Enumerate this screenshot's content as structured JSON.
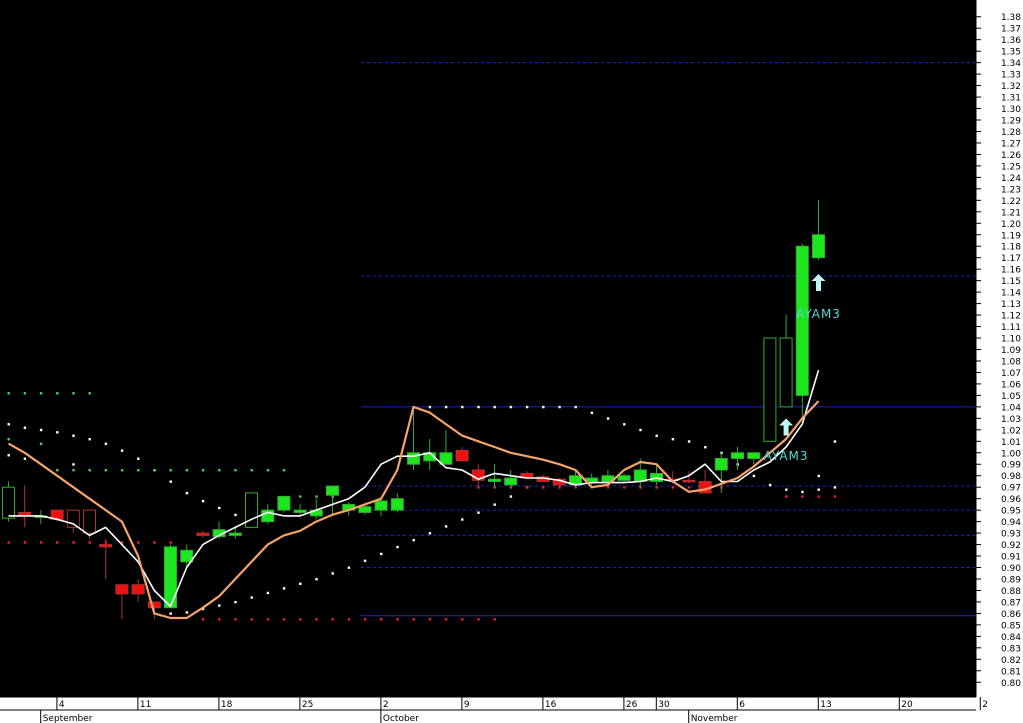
{
  "colors": {
    "background": "#000000",
    "panel": "#ffffff",
    "bull_candle": "#1ee61e",
    "bull_outline": "#33aa33",
    "bear_candle": "#ee1111",
    "bear_outline": "#aa3333",
    "fast_ma": "#ffffff",
    "slow_ma": "#f4a46a",
    "level_line": "#2222cc",
    "signal": "#55d7d7"
  },
  "chart_data": {
    "type": "candlestick",
    "title": "",
    "ylim": [
      0.795,
      1.385
    ],
    "y_ticks": [
      "1.38",
      "1.37",
      "1.36",
      "1.35",
      "1.34",
      "1.33",
      "1.32",
      "1.31",
      "1.30",
      "1.29",
      "1.28",
      "1.27",
      "1.26",
      "1.25",
      "1.24",
      "1.23",
      "1.22",
      "1.21",
      "1.20",
      "1.19",
      "1.18",
      "1.17",
      "1.16",
      "1.15",
      "1.14",
      "1.13",
      "1.12",
      "1.11",
      "1.10",
      "1.09",
      "1.08",
      "1.07",
      "1.06",
      "1.05",
      "1.04",
      "1.03",
      "1.02",
      "1.01",
      "1.00",
      "0.99",
      "0.98",
      "0.97",
      "0.96",
      "0.95",
      "0.94",
      "0.93",
      "0.92",
      "0.91",
      "0.90",
      "0.89",
      "0.88",
      "0.87",
      "0.86",
      "0.85",
      "0.84",
      "0.83",
      "0.82",
      "0.81",
      "0.80"
    ],
    "x_day_labels": [
      {
        "i": 2,
        "label": "4"
      },
      {
        "i": 7,
        "label": "11"
      },
      {
        "i": 12,
        "label": "18"
      },
      {
        "i": 17,
        "label": "25"
      },
      {
        "i": 22,
        "label": "2"
      },
      {
        "i": 27,
        "label": "9"
      },
      {
        "i": 32,
        "label": "16"
      },
      {
        "i": 37,
        "label": "26"
      },
      {
        "i": 39,
        "label": "30"
      },
      {
        "i": 44,
        "label": "6"
      },
      {
        "i": 49,
        "label": "13"
      },
      {
        "i": 54,
        "label": "20"
      },
      {
        "i": 59,
        "label": "2"
      }
    ],
    "x_month_labels": [
      {
        "i": 1,
        "label": "September"
      },
      {
        "i": 22,
        "label": "October"
      },
      {
        "i": 41,
        "label": "November"
      }
    ],
    "candles": [
      {
        "o": 0.943,
        "h": 0.975,
        "l": 0.94,
        "c": 0.97
      },
      {
        "o": 0.948,
        "h": 0.972,
        "l": 0.935,
        "c": 0.945
      },
      {
        "o": 0.945,
        "h": 0.95,
        "l": 0.938,
        "c": 0.945
      },
      {
        "o": 0.95,
        "h": 0.95,
        "l": 0.94,
        "c": 0.942
      },
      {
        "o": 0.95,
        "h": 0.95,
        "l": 0.93,
        "c": 0.935
      },
      {
        "o": 0.95,
        "h": 0.95,
        "l": 0.925,
        "c": 0.93
      },
      {
        "o": 0.92,
        "h": 0.925,
        "l": 0.89,
        "c": 0.918
      },
      {
        "o": 0.885,
        "h": 0.885,
        "l": 0.855,
        "c": 0.877
      },
      {
        "o": 0.885,
        "h": 0.89,
        "l": 0.87,
        "c": 0.877
      },
      {
        "o": 0.87,
        "h": 0.87,
        "l": 0.855,
        "c": 0.865
      },
      {
        "o": 0.865,
        "h": 0.92,
        "l": 0.865,
        "c": 0.918
      },
      {
        "o": 0.905,
        "h": 0.92,
        "l": 0.9,
        "c": 0.915
      },
      {
        "o": 0.93,
        "h": 0.932,
        "l": 0.926,
        "c": 0.928
      },
      {
        "o": 0.927,
        "h": 0.94,
        "l": 0.925,
        "c": 0.933
      },
      {
        "o": 0.928,
        "h": 0.935,
        "l": 0.925,
        "c": 0.93
      },
      {
        "o": 0.935,
        "h": 0.965,
        "l": 0.935,
        "c": 0.965
      },
      {
        "o": 0.94,
        "h": 0.955,
        "l": 0.938,
        "c": 0.95
      },
      {
        "o": 0.95,
        "h": 0.962,
        "l": 0.948,
        "c": 0.962
      },
      {
        "o": 0.948,
        "h": 0.955,
        "l": 0.945,
        "c": 0.95
      },
      {
        "o": 0.945,
        "h": 0.96,
        "l": 0.942,
        "c": 0.95
      },
      {
        "o": 0.963,
        "h": 0.965,
        "l": 0.945,
        "c": 0.971
      },
      {
        "o": 0.95,
        "h": 0.957,
        "l": 0.945,
        "c": 0.955
      },
      {
        "o": 0.948,
        "h": 0.955,
        "l": 0.946,
        "c": 0.953
      },
      {
        "o": 0.95,
        "h": 0.96,
        "l": 0.945,
        "c": 0.958
      },
      {
        "o": 0.95,
        "h": 0.965,
        "l": 0.948,
        "c": 0.96
      },
      {
        "o": 0.99,
        "h": 1.04,
        "l": 0.985,
        "c": 1.0
      },
      {
        "o": 0.993,
        "h": 1.012,
        "l": 0.985,
        "c": 1.0
      },
      {
        "o": 0.99,
        "h": 1.02,
        "l": 0.99,
        "c": 1.0
      },
      {
        "o": 1.002,
        "h": 1.005,
        "l": 0.995,
        "c": 0.993
      },
      {
        "o": 0.985,
        "h": 0.99,
        "l": 0.97,
        "c": 0.976
      },
      {
        "o": 0.975,
        "h": 0.99,
        "l": 0.97,
        "c": 0.977
      },
      {
        "o": 0.972,
        "h": 0.985,
        "l": 0.97,
        "c": 0.978
      },
      {
        "o": 0.982,
        "h": 0.984,
        "l": 0.977,
        "c": 0.978
      },
      {
        "o": 0.979,
        "h": 0.981,
        "l": 0.975,
        "c": 0.975
      },
      {
        "o": 0.977,
        "h": 0.978,
        "l": 0.97,
        "c": 0.972
      },
      {
        "o": 0.972,
        "h": 0.985,
        "l": 0.97,
        "c": 0.98
      },
      {
        "o": 0.975,
        "h": 0.982,
        "l": 0.972,
        "c": 0.978
      },
      {
        "o": 0.975,
        "h": 0.985,
        "l": 0.972,
        "c": 0.98
      },
      {
        "o": 0.976,
        "h": 0.982,
        "l": 0.974,
        "c": 0.98
      },
      {
        "o": 0.975,
        "h": 0.995,
        "l": 0.97,
        "c": 0.985
      },
      {
        "o": 0.975,
        "h": 0.99,
        "l": 0.972,
        "c": 0.982
      },
      {
        "o": 0.977,
        "h": 0.984,
        "l": 0.973,
        "c": 0.976
      },
      {
        "o": 0.976,
        "h": 0.984,
        "l": 0.973,
        "c": 0.975
      },
      {
        "o": 0.975,
        "h": 0.985,
        "l": 0.972,
        "c": 0.965
      },
      {
        "o": 0.985,
        "h": 1.0,
        "l": 0.965,
        "c": 0.995
      },
      {
        "o": 0.995,
        "h": 1.005,
        "l": 0.985,
        "c": 1.0
      },
      {
        "o": 0.995,
        "h": 1.0,
        "l": 0.99,
        "c": 1.0
      },
      {
        "o": 1.01,
        "h": 1.1,
        "l": 1.01,
        "c": 1.1
      },
      {
        "o": 1.04,
        "h": 1.12,
        "l": 1.04,
        "c": 1.1
      },
      {
        "o": 1.05,
        "h": 1.182,
        "l": 1.03,
        "c": 1.18
      },
      {
        "o": 1.17,
        "h": 1.22,
        "l": 1.168,
        "c": 1.19
      }
    ],
    "series": [
      {
        "name": "",
        "values": [
          0.945,
          0.945,
          0.945,
          0.942,
          0.938,
          0.928,
          0.935,
          0.92,
          0.905,
          0.88,
          0.866,
          0.9,
          0.92,
          0.928,
          0.935,
          0.942,
          0.948,
          0.945,
          0.945,
          0.95,
          0.955,
          0.96,
          0.97,
          0.99,
          0.997,
          0.997,
          1.0,
          0.987,
          0.985,
          0.977,
          0.982,
          0.98,
          0.978,
          0.978,
          0.976,
          0.972,
          0.974,
          0.974,
          0.974,
          0.975,
          0.978,
          0.975,
          0.98,
          0.99,
          0.975,
          0.975,
          0.985,
          0.992,
          1.005,
          1.025,
          1.072
        ]
      },
      {
        "name": "",
        "values": [
          1.008,
          1.0,
          0.99,
          0.98,
          0.97,
          0.96,
          0.95,
          0.94,
          0.91,
          0.86,
          0.856,
          0.856,
          0.865,
          0.875,
          0.89,
          0.905,
          0.92,
          0.928,
          0.932,
          0.94,
          0.946,
          0.95,
          0.955,
          0.96,
          0.985,
          1.04,
          1.035,
          1.025,
          1.015,
          1.01,
          1.005,
          1.0,
          0.997,
          0.994,
          0.99,
          0.985,
          0.97,
          0.972,
          0.985,
          0.992,
          0.99,
          0.975,
          0.966,
          0.968,
          0.973,
          0.978,
          0.988,
          1.0,
          1.012,
          1.03,
          1.045
        ]
      }
    ],
    "dots": {
      "white": [
        [
          0,
          1.025
        ],
        [
          1,
          1.022
        ],
        [
          2,
          1.02
        ],
        [
          3,
          1.018
        ],
        [
          4,
          1.015
        ],
        [
          5,
          1.012
        ],
        [
          6,
          1.008
        ],
        [
          7,
          1.002
        ],
        [
          8,
          0.995
        ],
        [
          9,
          0.985
        ],
        [
          10,
          0.975
        ],
        [
          11,
          0.965
        ],
        [
          12,
          0.958
        ],
        [
          13,
          0.952
        ],
        [
          14,
          0.946
        ],
        [
          0,
          0.998
        ],
        [
          1,
          0.995
        ],
        [
          4,
          0.99
        ],
        [
          10,
          0.86
        ],
        [
          11,
          0.861
        ],
        [
          12,
          0.864
        ],
        [
          13,
          0.867
        ],
        [
          14,
          0.87
        ],
        [
          15,
          0.874
        ],
        [
          16,
          0.878
        ],
        [
          17,
          0.882
        ],
        [
          18,
          0.886
        ],
        [
          19,
          0.89
        ],
        [
          20,
          0.895
        ],
        [
          21,
          0.9
        ],
        [
          22,
          0.906
        ],
        [
          23,
          0.912
        ],
        [
          24,
          0.918
        ],
        [
          25,
          0.924
        ],
        [
          26,
          0.93
        ],
        [
          27,
          0.936
        ],
        [
          28,
          0.942
        ],
        [
          29,
          0.948
        ],
        [
          30,
          0.955
        ],
        [
          31,
          0.962
        ],
        [
          32,
          0.97
        ],
        [
          26,
          1.04
        ],
        [
          27,
          1.04
        ],
        [
          28,
          1.04
        ],
        [
          29,
          1.04
        ],
        [
          30,
          1.04
        ],
        [
          31,
          1.04
        ],
        [
          32,
          1.04
        ],
        [
          33,
          1.04
        ],
        [
          34,
          1.04
        ],
        [
          35,
          1.04
        ],
        [
          36,
          1.035
        ],
        [
          37,
          1.03
        ],
        [
          38,
          1.025
        ],
        [
          39,
          1.02
        ],
        [
          40,
          1.015
        ],
        [
          41,
          1.012
        ],
        [
          42,
          1.01
        ],
        [
          43,
          1.005
        ],
        [
          44,
          1.0
        ],
        [
          45,
          0.99
        ],
        [
          46,
          0.98
        ],
        [
          47,
          0.972
        ],
        [
          48,
          0.968
        ],
        [
          49,
          0.966
        ],
        [
          50,
          0.968
        ],
        [
          51,
          0.97
        ],
        [
          50,
          0.98
        ],
        [
          51,
          1.01
        ]
      ],
      "green": [
        [
          0,
          1.052
        ],
        [
          1,
          1.052
        ],
        [
          2,
          1.052
        ],
        [
          3,
          1.052
        ],
        [
          4,
          1.052
        ],
        [
          5,
          1.052
        ],
        [
          3,
          0.985
        ],
        [
          4,
          0.985
        ],
        [
          5,
          0.985
        ],
        [
          6,
          0.985
        ],
        [
          7,
          0.985
        ],
        [
          8,
          0.985
        ],
        [
          9,
          0.985
        ],
        [
          10,
          0.985
        ],
        [
          11,
          0.985
        ],
        [
          12,
          0.985
        ],
        [
          13,
          0.985
        ],
        [
          14,
          0.985
        ],
        [
          15,
          0.985
        ],
        [
          16,
          0.985
        ],
        [
          17,
          0.985
        ],
        [
          18,
          0.962
        ],
        [
          19,
          0.962
        ],
        [
          20,
          0.962
        ],
        [
          0,
          1.012
        ],
        [
          2,
          1.008
        ]
      ],
      "red": [
        [
          0,
          0.922
        ],
        [
          1,
          0.922
        ],
        [
          2,
          0.922
        ],
        [
          3,
          0.922
        ],
        [
          4,
          0.922
        ],
        [
          5,
          0.922
        ],
        [
          6,
          0.922
        ],
        [
          7,
          0.922
        ],
        [
          8,
          0.922
        ],
        [
          9,
          0.922
        ],
        [
          10,
          0.922
        ],
        [
          12,
          0.855
        ],
        [
          13,
          0.855
        ],
        [
          14,
          0.855
        ],
        [
          15,
          0.855
        ],
        [
          16,
          0.855
        ],
        [
          17,
          0.855
        ],
        [
          18,
          0.855
        ],
        [
          19,
          0.855
        ],
        [
          20,
          0.855
        ],
        [
          21,
          0.855
        ],
        [
          22,
          0.855
        ],
        [
          23,
          0.855
        ],
        [
          24,
          0.855
        ],
        [
          25,
          0.855
        ],
        [
          26,
          0.855
        ],
        [
          27,
          0.855
        ],
        [
          28,
          0.855
        ],
        [
          29,
          0.855
        ],
        [
          30,
          0.855
        ],
        [
          29,
          0.97
        ],
        [
          30,
          0.97
        ],
        [
          31,
          0.97
        ],
        [
          32,
          0.97
        ],
        [
          33,
          0.97
        ],
        [
          34,
          0.97
        ],
        [
          35,
          0.97
        ],
        [
          36,
          0.97
        ],
        [
          37,
          0.97
        ],
        [
          38,
          0.97
        ],
        [
          39,
          0.97
        ],
        [
          40,
          0.97
        ],
        [
          41,
          0.97
        ],
        [
          42,
          0.97
        ],
        [
          43,
          0.97
        ],
        [
          44,
          0.97
        ],
        [
          48,
          0.962
        ],
        [
          49,
          0.962
        ],
        [
          50,
          0.962
        ],
        [
          51,
          0.962
        ]
      ]
    },
    "h_lines": [
      {
        "y": 1.34,
        "style": "dashed",
        "x_from_i": 22
      },
      {
        "y": 1.154,
        "style": "dashed",
        "x_from_i": 22
      },
      {
        "y": 1.04,
        "style": "solid",
        "x_from_i": 22
      },
      {
        "y": 0.971,
        "style": "dashed",
        "x_from_i": 22
      },
      {
        "y": 0.95,
        "style": "dashed",
        "x_from_i": 22
      },
      {
        "y": 0.928,
        "style": "dashed",
        "x_from_i": 22
      },
      {
        "y": 0.9,
        "style": "dashed",
        "x_from_i": 22
      },
      {
        "y": 0.858,
        "style": "solid",
        "x_from_i": 22
      }
    ],
    "signals": [
      {
        "i": 50,
        "price": 1.148,
        "label": "AYAM3",
        "label_price": 1.121
      },
      {
        "i": 48,
        "price": 1.022,
        "label": "AYAM3",
        "label_price": 0.997
      }
    ]
  }
}
